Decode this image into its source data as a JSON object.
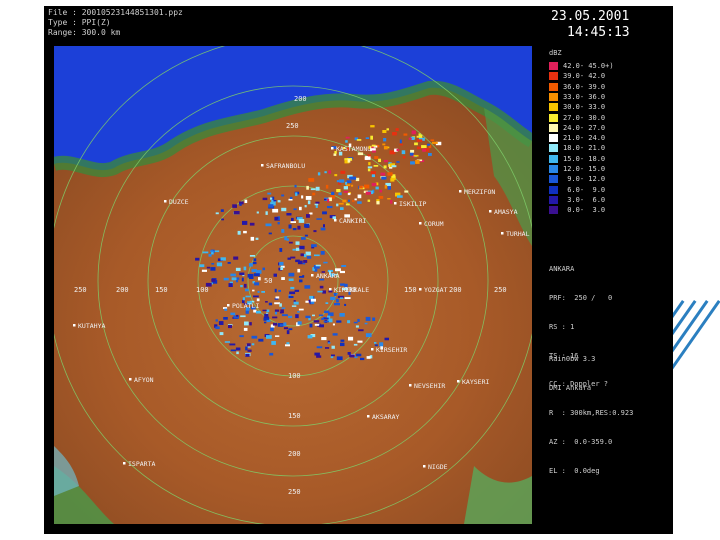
{
  "file_info": {
    "file_line": "File : 20010523144851301.ppz",
    "type_line": "Type : PPI(Z)",
    "range_line": "Range: 300.0 km"
  },
  "sidebar": {
    "date": "23.05.2001",
    "time": "14:45:13",
    "unit": "dBZ",
    "legend": [
      {
        "label": "42.0- 45.0+)",
        "color": "#e0205a"
      },
      {
        "label": "39.0- 42.0",
        "color": "#e83010"
      },
      {
        "label": "36.0- 39.0",
        "color": "#f05a00"
      },
      {
        "label": "33.0- 36.0",
        "color": "#f89000"
      },
      {
        "label": "30.0- 33.0",
        "color": "#f8c400"
      },
      {
        "label": "27.0- 30.0",
        "color": "#f8ec30"
      },
      {
        "label": "24.0- 27.0",
        "color": "#fff8b0"
      },
      {
        "label": "21.0- 24.0",
        "color": "#ffffff"
      },
      {
        "label": "18.0- 21.0",
        "color": "#90e8f8"
      },
      {
        "label": "15.0- 18.0",
        "color": "#40b8f0"
      },
      {
        "label": "12.0- 15.0",
        "color": "#2a88e8"
      },
      {
        "label": " 9.0- 12.0",
        "color": "#1a58d8"
      },
      {
        "label": " 6.0-  9.0",
        "color": "#1030c0"
      },
      {
        "label": " 3.0-  6.0",
        "color": "#2418a8"
      },
      {
        "label": " 0.0-  3.0",
        "color": "#3a1090"
      }
    ],
    "meta_lines": [
      "ANKARA",
      "PRF:  250 /   0",
      "RS : 1",
      "TS : 16",
      "CC : Doppler ?",
      "R  : 300km,RES:0.923",
      "AZ :  0.0-359.0",
      "EL :  0.0deg"
    ],
    "credit_lines": [
      "Rain0bw 3.3",
      "DMI Ankara"
    ]
  },
  "map": {
    "range_labels": [
      "250",
      "200",
      "150",
      "100",
      "50",
      "100",
      "150",
      "200",
      "250",
      "200",
      "250",
      "100",
      "150",
      "200",
      "250"
    ],
    "cities": [
      "KASTAMONU",
      "SAFRANBOLU",
      "DUZCE",
      "MERZIFON",
      "AMASYA",
      "TURHAL",
      "CANKIRI",
      "ISKILIP",
      "CORUM",
      "ANKARA",
      "KIRIKKALE",
      "YOZGAT",
      "POLATLI",
      "KUTAHYA",
      "AFYON",
      "KIRSEHIR",
      "NEVSEHIR",
      "KAYSERI",
      "AKSARAY",
      "NIGDE",
      "ISPARTA"
    ]
  }
}
